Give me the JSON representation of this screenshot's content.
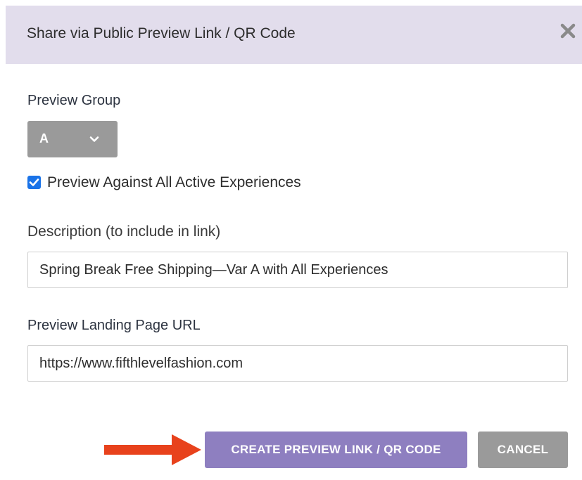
{
  "modal": {
    "title": "Share via Public Preview Link / QR Code",
    "close_icon": "close-icon"
  },
  "preview_group": {
    "label": "Preview Group",
    "selected": "A",
    "chevron_icon": "chevron-down-icon"
  },
  "all_experiences": {
    "label": "Preview Against All Active Experiences",
    "checked": true
  },
  "description": {
    "label": "Description (to include in link)",
    "value": "Spring Break Free Shipping—Var A with All Experiences"
  },
  "landing_url": {
    "label": "Preview Landing Page URL",
    "value": "https://www.fifthlevelfashion.com"
  },
  "actions": {
    "create_label": "CREATE PREVIEW LINK / QR CODE",
    "cancel_label": "CANCEL"
  },
  "colors": {
    "header_bg": "#e2ddec",
    "primary_button": "#8e7fc0",
    "secondary_button": "#9a9a9a",
    "annotation_arrow": "#e8421c",
    "checkbox": "#1a73e8"
  }
}
